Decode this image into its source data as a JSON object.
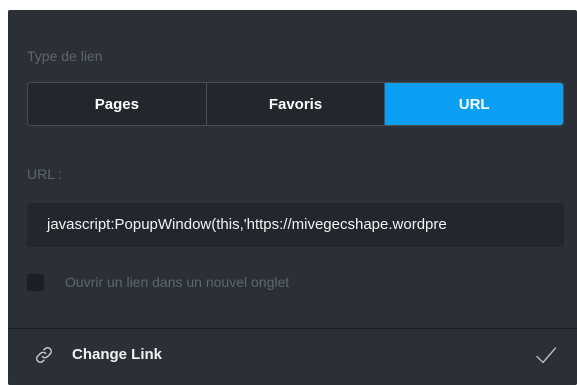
{
  "dialog": {
    "link_type_label": "Type de lien",
    "tabs": [
      {
        "label": "Pages",
        "active": false
      },
      {
        "label": "Favoris",
        "active": false
      },
      {
        "label": "URL",
        "active": true
      }
    ],
    "url_label": "URL :",
    "url_value": "javascript:PopupWindow(this,'https://mivegecshape.wordpre",
    "new_tab_label": "Ouvrir un lien dans un nouvel onglet",
    "new_tab_checked": false
  },
  "footer": {
    "title": "Change Link",
    "left_icon": "link-icon",
    "right_icon": "checkmark-icon"
  },
  "colors": {
    "panel_bg": "#2b2f36",
    "field_bg": "#23272d",
    "accent": "#0a9ff2",
    "muted_text": "#5f6670",
    "text": "#f1f2f4"
  }
}
